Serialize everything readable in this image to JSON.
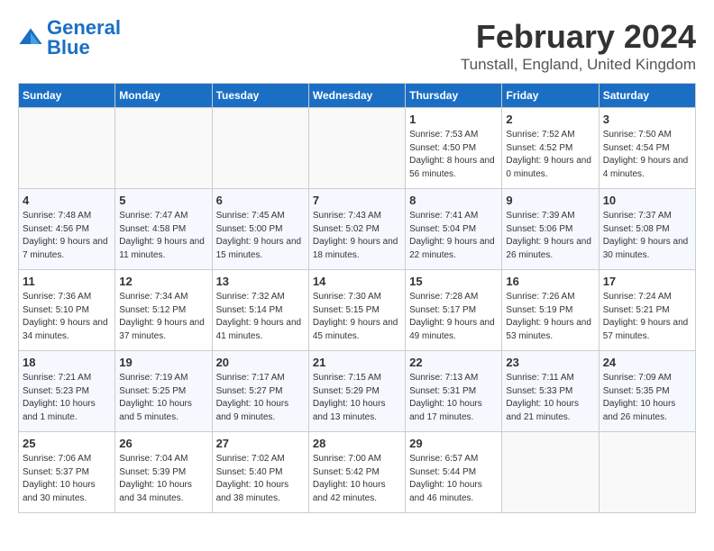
{
  "header": {
    "logo_general": "General",
    "logo_blue": "Blue",
    "month_year": "February 2024",
    "location": "Tunstall, England, United Kingdom"
  },
  "weekdays": [
    "Sunday",
    "Monday",
    "Tuesday",
    "Wednesday",
    "Thursday",
    "Friday",
    "Saturday"
  ],
  "weeks": [
    [
      {
        "day": "",
        "empty": true
      },
      {
        "day": "",
        "empty": true
      },
      {
        "day": "",
        "empty": true
      },
      {
        "day": "",
        "empty": true
      },
      {
        "day": "1",
        "sunrise": "7:53 AM",
        "sunset": "4:50 PM",
        "daylight": "8 hours and 56 minutes."
      },
      {
        "day": "2",
        "sunrise": "7:52 AM",
        "sunset": "4:52 PM",
        "daylight": "9 hours and 0 minutes."
      },
      {
        "day": "3",
        "sunrise": "7:50 AM",
        "sunset": "4:54 PM",
        "daylight": "9 hours and 4 minutes."
      }
    ],
    [
      {
        "day": "4",
        "sunrise": "7:48 AM",
        "sunset": "4:56 PM",
        "daylight": "9 hours and 7 minutes."
      },
      {
        "day": "5",
        "sunrise": "7:47 AM",
        "sunset": "4:58 PM",
        "daylight": "9 hours and 11 minutes."
      },
      {
        "day": "6",
        "sunrise": "7:45 AM",
        "sunset": "5:00 PM",
        "daylight": "9 hours and 15 minutes."
      },
      {
        "day": "7",
        "sunrise": "7:43 AM",
        "sunset": "5:02 PM",
        "daylight": "9 hours and 18 minutes."
      },
      {
        "day": "8",
        "sunrise": "7:41 AM",
        "sunset": "5:04 PM",
        "daylight": "9 hours and 22 minutes."
      },
      {
        "day": "9",
        "sunrise": "7:39 AM",
        "sunset": "5:06 PM",
        "daylight": "9 hours and 26 minutes."
      },
      {
        "day": "10",
        "sunrise": "7:37 AM",
        "sunset": "5:08 PM",
        "daylight": "9 hours and 30 minutes."
      }
    ],
    [
      {
        "day": "11",
        "sunrise": "7:36 AM",
        "sunset": "5:10 PM",
        "daylight": "9 hours and 34 minutes."
      },
      {
        "day": "12",
        "sunrise": "7:34 AM",
        "sunset": "5:12 PM",
        "daylight": "9 hours and 37 minutes."
      },
      {
        "day": "13",
        "sunrise": "7:32 AM",
        "sunset": "5:14 PM",
        "daylight": "9 hours and 41 minutes."
      },
      {
        "day": "14",
        "sunrise": "7:30 AM",
        "sunset": "5:15 PM",
        "daylight": "9 hours and 45 minutes."
      },
      {
        "day": "15",
        "sunrise": "7:28 AM",
        "sunset": "5:17 PM",
        "daylight": "9 hours and 49 minutes."
      },
      {
        "day": "16",
        "sunrise": "7:26 AM",
        "sunset": "5:19 PM",
        "daylight": "9 hours and 53 minutes."
      },
      {
        "day": "17",
        "sunrise": "7:24 AM",
        "sunset": "5:21 PM",
        "daylight": "9 hours and 57 minutes."
      }
    ],
    [
      {
        "day": "18",
        "sunrise": "7:21 AM",
        "sunset": "5:23 PM",
        "daylight": "10 hours and 1 minute."
      },
      {
        "day": "19",
        "sunrise": "7:19 AM",
        "sunset": "5:25 PM",
        "daylight": "10 hours and 5 minutes."
      },
      {
        "day": "20",
        "sunrise": "7:17 AM",
        "sunset": "5:27 PM",
        "daylight": "10 hours and 9 minutes."
      },
      {
        "day": "21",
        "sunrise": "7:15 AM",
        "sunset": "5:29 PM",
        "daylight": "10 hours and 13 minutes."
      },
      {
        "day": "22",
        "sunrise": "7:13 AM",
        "sunset": "5:31 PM",
        "daylight": "10 hours and 17 minutes."
      },
      {
        "day": "23",
        "sunrise": "7:11 AM",
        "sunset": "5:33 PM",
        "daylight": "10 hours and 21 minutes."
      },
      {
        "day": "24",
        "sunrise": "7:09 AM",
        "sunset": "5:35 PM",
        "daylight": "10 hours and 26 minutes."
      }
    ],
    [
      {
        "day": "25",
        "sunrise": "7:06 AM",
        "sunset": "5:37 PM",
        "daylight": "10 hours and 30 minutes."
      },
      {
        "day": "26",
        "sunrise": "7:04 AM",
        "sunset": "5:39 PM",
        "daylight": "10 hours and 34 minutes."
      },
      {
        "day": "27",
        "sunrise": "7:02 AM",
        "sunset": "5:40 PM",
        "daylight": "10 hours and 38 minutes."
      },
      {
        "day": "28",
        "sunrise": "7:00 AM",
        "sunset": "5:42 PM",
        "daylight": "10 hours and 42 minutes."
      },
      {
        "day": "29",
        "sunrise": "6:57 AM",
        "sunset": "5:44 PM",
        "daylight": "10 hours and 46 minutes."
      },
      {
        "day": "",
        "empty": true
      },
      {
        "day": "",
        "empty": true
      }
    ]
  ]
}
